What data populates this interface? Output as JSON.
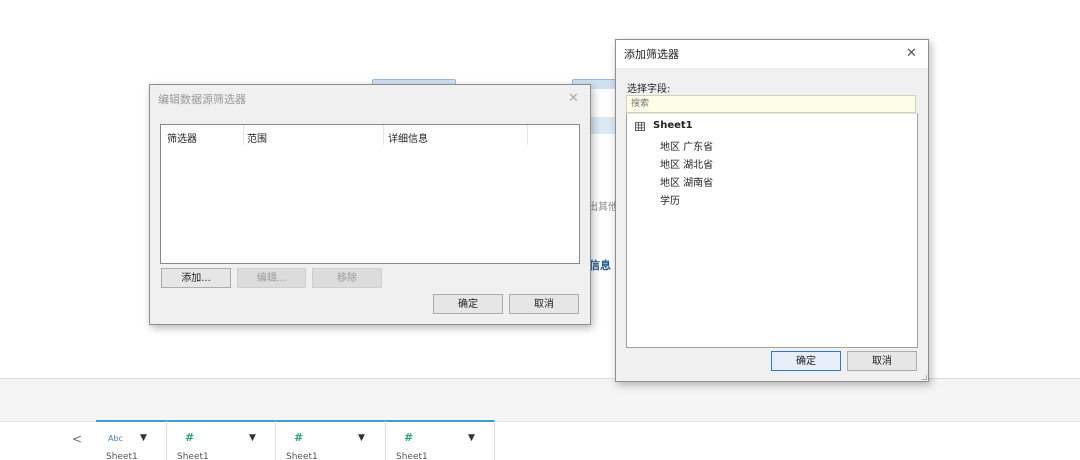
{
  "background": {
    "fragment_text": "出其他",
    "fragment_bold": "信息"
  },
  "field_strip": {
    "scroll_left": "<",
    "columns": [
      {
        "icon": "Abc",
        "icon_name": "abc-icon"
      },
      {
        "icon": "#",
        "icon_name": "number-icon"
      },
      {
        "icon": "#",
        "icon_name": "number-icon"
      },
      {
        "icon": "#",
        "icon_name": "number-icon"
      }
    ],
    "dropdown_glyph": "▼"
  },
  "edit_dialog": {
    "title": "编辑数据源筛选器",
    "close": "✕",
    "headers": [
      "筛选器",
      "范围",
      "详细信息"
    ],
    "rows": [],
    "buttons": {
      "add": "添加...",
      "edit": "编辑...",
      "remove": "移除",
      "ok": "确定",
      "cancel": "取消"
    }
  },
  "add_dialog": {
    "title": "添加筛选器",
    "close": "✕",
    "field_label": "选择字段:",
    "search_placeholder": "搜索",
    "tree": {
      "root": "Sheet1",
      "items": [
        "地区 广东省",
        "地区 湖北省",
        "地区 湖南省",
        "学历"
      ]
    },
    "buttons": {
      "ok": "确定",
      "cancel": "取消"
    }
  },
  "colors": {
    "accent": "#2f79c6",
    "search_bg": "#fdfde8",
    "strip_accent": "#3b9ec9"
  }
}
